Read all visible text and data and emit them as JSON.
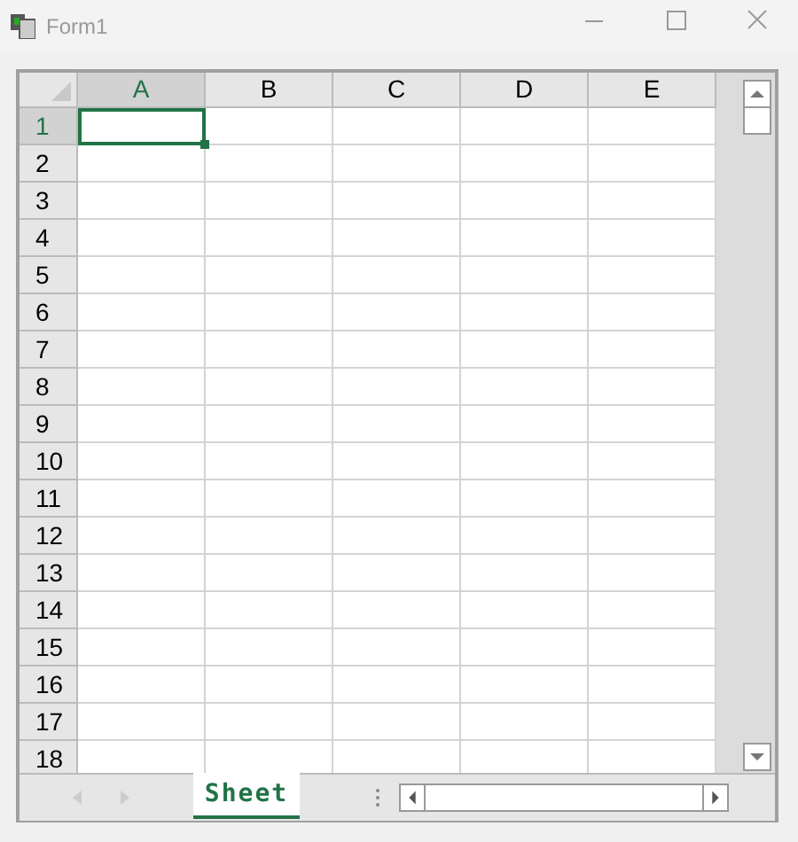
{
  "window": {
    "title": "Form1"
  },
  "spreadsheet": {
    "columns": [
      {
        "label": "A",
        "selected": true
      },
      {
        "label": "B",
        "selected": false
      },
      {
        "label": "C",
        "selected": false
      },
      {
        "label": "D",
        "selected": false
      },
      {
        "label": "E",
        "selected": false
      }
    ],
    "rows": [
      {
        "label": "1",
        "selected": true
      },
      {
        "label": "2",
        "selected": false
      },
      {
        "label": "3",
        "selected": false
      },
      {
        "label": "4",
        "selected": false
      },
      {
        "label": "5",
        "selected": false
      },
      {
        "label": "6",
        "selected": false
      },
      {
        "label": "7",
        "selected": false
      },
      {
        "label": "8",
        "selected": false
      },
      {
        "label": "9",
        "selected": false
      },
      {
        "label": "10",
        "selected": false
      },
      {
        "label": "11",
        "selected": false
      },
      {
        "label": "12",
        "selected": false
      },
      {
        "label": "13",
        "selected": false
      },
      {
        "label": "14",
        "selected": false
      },
      {
        "label": "15",
        "selected": false
      },
      {
        "label": "16",
        "selected": false
      },
      {
        "label": "17",
        "selected": false
      },
      {
        "label": "18",
        "selected": false
      }
    ]
  },
  "sheet_tabs": [
    {
      "label": "Sheet",
      "selected": true
    }
  ]
}
